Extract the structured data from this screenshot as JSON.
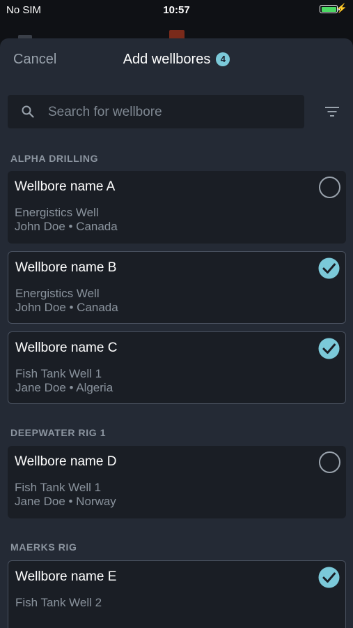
{
  "status_bar": {
    "carrier": "No SIM",
    "time": "10:57",
    "battery_level": 1.0
  },
  "nav": {
    "cancel_label": "Cancel",
    "title": "Add wellbores",
    "badge_count": "4"
  },
  "search": {
    "placeholder": "Search for wellbore",
    "value": ""
  },
  "icons": {
    "search": "search-icon",
    "filter": "filter-icon",
    "check": "check-circle-icon",
    "radio": "radio-empty-icon"
  },
  "colors": {
    "accent": "#7bc9d9",
    "background": "#242a35",
    "card": "#1a1e25"
  },
  "sections": [
    {
      "title": "ALPHA DRILLING",
      "items": [
        {
          "name": "Wellbore name A",
          "well": "Energistics Well",
          "meta": "John Doe • Canada",
          "selected": false
        },
        {
          "name": "Wellbore name B",
          "well": "Energistics Well",
          "meta": "John Doe • Canada",
          "selected": true
        },
        {
          "name": "Wellbore name C",
          "well": "Fish Tank Well 1",
          "meta": "Jane Doe • Algeria",
          "selected": true
        }
      ]
    },
    {
      "title": "DEEPWATER RIG 1",
      "items": [
        {
          "name": "Wellbore name D",
          "well": "Fish Tank Well 1",
          "meta": "Jane Doe • Norway",
          "selected": false
        }
      ]
    },
    {
      "title": "MAERKS RIG",
      "items": [
        {
          "name": "Wellbore name E",
          "well": "Fish Tank Well 2",
          "meta": "",
          "selected": true
        }
      ]
    }
  ]
}
